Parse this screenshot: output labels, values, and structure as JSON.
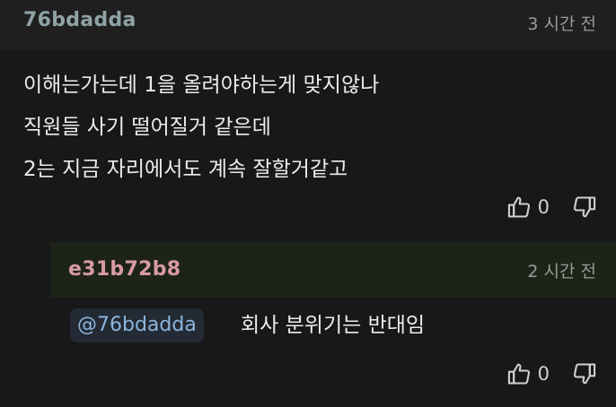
{
  "comment": {
    "author": "76bdadda",
    "time": "3 시간 전",
    "lines": [
      "이해는가는데 1을 올려야하는게 맞지않나",
      "직원들 사기 떨어질거 같은데",
      "2는 지금 자리에서도 계속 잘할거같고"
    ],
    "likes": "0",
    "like_icon": "thumbs-up-icon",
    "dislike_icon": "thumbs-down-icon"
  },
  "reply": {
    "author": "e31b72b8",
    "time": "2 시간 전",
    "mention": "@76bdadda",
    "text": "회사 분위기는 반대임",
    "likes": "0"
  },
  "colors": {
    "background": "#181818",
    "comment_author": "#8fa3a6",
    "reply_author": "#d99aa8",
    "mention": "#8bb5dd",
    "reply_header_bg": "#1d2417"
  }
}
